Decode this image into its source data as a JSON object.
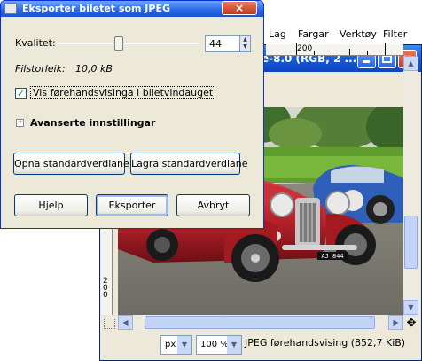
{
  "dialog": {
    "title": "Eksporter biletet som JPEG",
    "close_label": "×",
    "quality_label": "Kvalitet:",
    "quality_value": "44",
    "quality_fraction": 0.44,
    "filesize_label": "Filstorleik:",
    "filesize_value": "10,0 kB",
    "preview_label": "Vis førehandsvisinga i biletvindauget",
    "preview_checked": true,
    "advanced_label": "Avanserte innstillingar",
    "load_defaults": "Opna standardverdiane",
    "save_defaults": "Lagra standardverdiane",
    "help": "Hjelp",
    "export": "Eksporter",
    "cancel": "Avbryt"
  },
  "image_window": {
    "title": "e-8.0 (RGB, 2 ...",
    "menus": [
      "Lag",
      "Fargar",
      "Verktøy",
      "Filter"
    ],
    "ruler_h_label": "200",
    "ruler_v_label": "200",
    "unit": "px",
    "zoom": "100 %",
    "status": "JPEG førehandsvising (852,7 KiB)",
    "plate": "AJ 844"
  },
  "colors": {
    "xp_blue": "#2764e6",
    "car_red": "#b8222a",
    "grass": "#5f9e2e"
  }
}
